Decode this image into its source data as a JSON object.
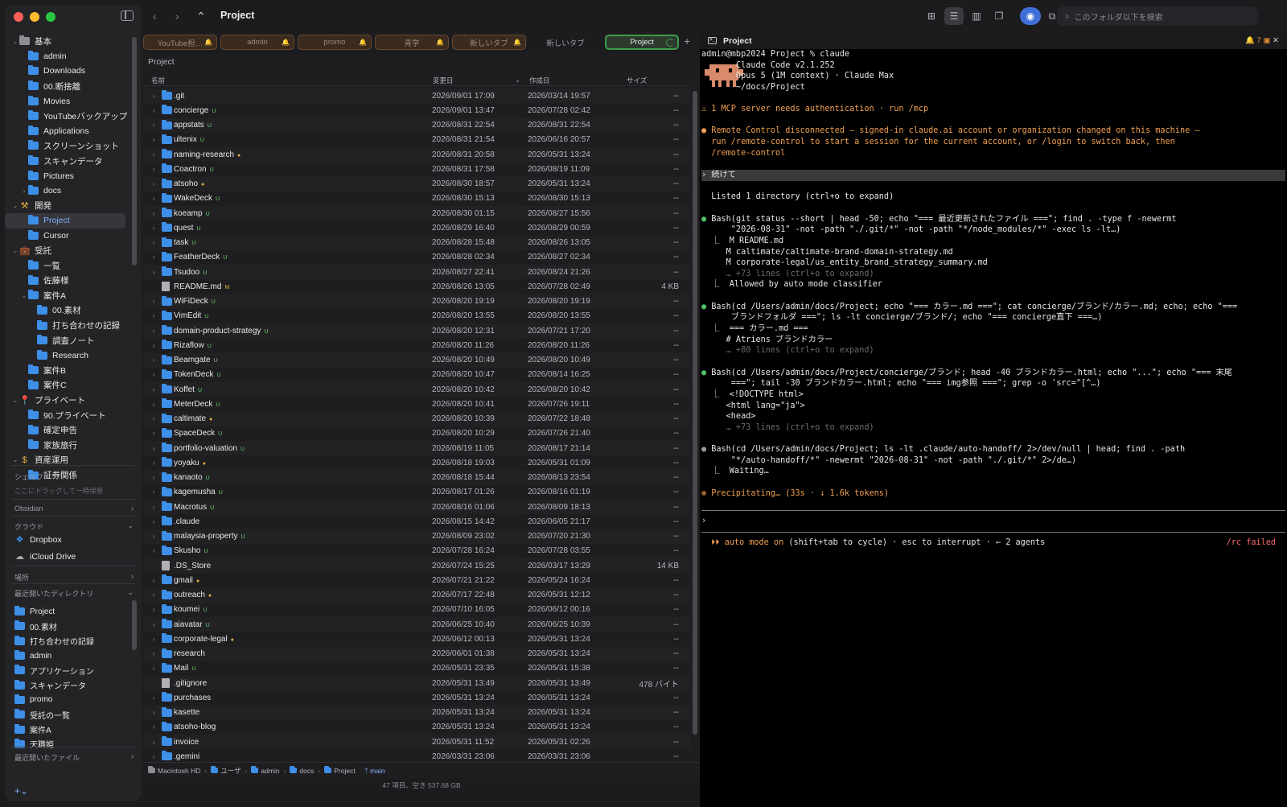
{
  "window": {
    "title": "Project"
  },
  "sidebar": {
    "tree": [
      {
        "label": "基本",
        "chev": "⌄",
        "icon": "grey",
        "indent": 0
      },
      {
        "label": "admin",
        "indent": 1,
        "icon": "folder"
      },
      {
        "label": "Downloads",
        "indent": 1,
        "icon": "folder"
      },
      {
        "label": "00.断捨離",
        "indent": 1,
        "icon": "folder"
      },
      {
        "label": "Movies",
        "indent": 1,
        "icon": "folder"
      },
      {
        "label": "YouTubeバックアップ",
        "indent": 1,
        "icon": "folder"
      },
      {
        "label": "Applications",
        "indent": 1,
        "icon": "folder"
      },
      {
        "label": "スクリーンショット",
        "indent": 1,
        "icon": "folder"
      },
      {
        "label": "スキャンデータ",
        "indent": 1,
        "icon": "folder"
      },
      {
        "label": "Pictures",
        "indent": 1,
        "icon": "folder"
      },
      {
        "label": "docs",
        "indent": 1,
        "chev": "›",
        "icon": "folder"
      },
      {
        "label": "開発",
        "chev": "⌄",
        "indent": 0,
        "icon": "hammer"
      },
      {
        "label": "Project",
        "indent": 1,
        "icon": "folder",
        "selected": true
      },
      {
        "label": "Cursor",
        "indent": 1,
        "icon": "folder"
      },
      {
        "label": "受託",
        "chev": "⌄",
        "indent": 0,
        "icon": "briefcase"
      },
      {
        "label": "一覧",
        "indent": 1,
        "icon": "folder"
      },
      {
        "label": "佐藤様",
        "indent": 1,
        "icon": "folder"
      },
      {
        "label": "案件A",
        "indent": 1,
        "chev": "⌄",
        "icon": "folder"
      },
      {
        "label": "00.素材",
        "indent": 2,
        "icon": "folder"
      },
      {
        "label": "打ち合わせの記録",
        "indent": 2,
        "icon": "folder"
      },
      {
        "label": "調査ノート",
        "indent": 2,
        "icon": "folder"
      },
      {
        "label": "Research",
        "indent": 2,
        "icon": "folder"
      },
      {
        "label": "案件B",
        "indent": 1,
        "icon": "folder"
      },
      {
        "label": "案件C",
        "indent": 1,
        "icon": "folder"
      },
      {
        "label": "プライベート",
        "chev": "⌄",
        "indent": 0,
        "icon": "pin"
      },
      {
        "label": "90.プライベート",
        "indent": 1,
        "icon": "folder"
      },
      {
        "label": "確定申告",
        "indent": 1,
        "icon": "folder"
      },
      {
        "label": "家族旅行",
        "indent": 1,
        "icon": "folder"
      },
      {
        "label": "資産運用",
        "chev": "⌄",
        "indent": 0,
        "icon": "dollar"
      },
      {
        "label": "証券関係",
        "indent": 1,
        "icon": "folder"
      }
    ],
    "shelf_title": "シェルフ",
    "shelf_hint": "ここにドラッグして一時保管",
    "obsidian": "Obsidian",
    "cloud_title": "クラウド",
    "dropbox": "Dropbox",
    "icloud": "iCloud Drive",
    "places": "場所",
    "recent_dirs_title": "最近開いたディレクトリ",
    "recent_dirs": [
      "Project",
      "00.素材",
      "打ち合わせの記録",
      "admin",
      "アプリケーション",
      "スキャンデータ",
      "promo",
      "受託の一覧",
      "案件A",
      "天職姫"
    ],
    "recent_files": "最近開いたファイル",
    "add": "+⌄"
  },
  "toolbar": {
    "back": "‹",
    "forward": "›",
    "up": "⌃",
    "search_placeholder": "このフォルダ以下を検索"
  },
  "tabs": [
    {
      "label": "YouTube担…",
      "style": "bell"
    },
    {
      "label": "admin",
      "style": "bell"
    },
    {
      "label": "promo",
      "style": "bell"
    },
    {
      "label": "青学",
      "style": "bell"
    },
    {
      "label": "新しいタブ",
      "style": "bell"
    },
    {
      "label": "新しいタブ",
      "style": "plain"
    },
    {
      "label": "Project",
      "style": "active"
    }
  ],
  "filelist": {
    "path_title": "Project",
    "columns": {
      "name": "名前",
      "modified": "変更日",
      "created": "作成日",
      "size": "サイズ"
    },
    "rows": [
      {
        "n": ".git",
        "m": "2026/09/01 17:09",
        "c": "2026/03/14 19:57",
        "s": "--",
        "b": ""
      },
      {
        "n": "concierge",
        "m": "2026/09/01 13:47",
        "c": "2026/07/28 02:42",
        "s": "--",
        "b": "U"
      },
      {
        "n": "appstats",
        "m": "2026/08/31 22:54",
        "c": "2026/08/31 22:54",
        "s": "--",
        "b": "U"
      },
      {
        "n": "ultenix",
        "m": "2026/08/31 21:54",
        "c": "2026/06/16 20:57",
        "s": "--",
        "b": "U"
      },
      {
        "n": "naming-research",
        "m": "2026/08/31 20:58",
        "c": "2026/05/31 13:24",
        "s": "--",
        "b": "●"
      },
      {
        "n": "Coactron",
        "m": "2026/08/31 17:58",
        "c": "2026/08/19 11:09",
        "s": "--",
        "b": "U"
      },
      {
        "n": "atsoho",
        "m": "2026/08/30 18:57",
        "c": "2026/05/31 13:24",
        "s": "--",
        "b": "●"
      },
      {
        "n": "WakeDeck",
        "m": "2026/08/30 15:13",
        "c": "2026/08/30 15:13",
        "s": "--",
        "b": "U"
      },
      {
        "n": "koeamp",
        "m": "2026/08/30 01:15",
        "c": "2026/08/27 15:56",
        "s": "--",
        "b": "U"
      },
      {
        "n": "quest",
        "m": "2026/08/29 16:40",
        "c": "2026/08/29 00:59",
        "s": "--",
        "b": "U"
      },
      {
        "n": "task",
        "m": "2026/08/28 15:48",
        "c": "2026/08/26 13:05",
        "s": "--",
        "b": "U"
      },
      {
        "n": "FeatherDeck",
        "m": "2026/08/28 02:34",
        "c": "2026/08/27 02:34",
        "s": "--",
        "b": "U"
      },
      {
        "n": "Tsudoo",
        "m": "2026/08/27 22:41",
        "c": "2026/08/24 21:26",
        "s": "--",
        "b": "U"
      },
      {
        "n": "README.md",
        "m": "2026/08/26 13:05",
        "c": "2026/07/28 02:49",
        "s": "4 KB",
        "b": "M",
        "file": true
      },
      {
        "n": "WiFiDeck",
        "m": "2026/08/20 19:19",
        "c": "2026/08/20 19:19",
        "s": "--",
        "b": "U"
      },
      {
        "n": "VimEdit",
        "m": "2026/08/20 13:55",
        "c": "2026/08/20 13:55",
        "s": "--",
        "b": "U"
      },
      {
        "n": "domain-product-strategy",
        "m": "2026/08/20 12:31",
        "c": "2026/07/21 17:20",
        "s": "--",
        "b": "U"
      },
      {
        "n": "Rizaflow",
        "m": "2026/08/20 11:26",
        "c": "2026/08/20 11:26",
        "s": "--",
        "b": "U"
      },
      {
        "n": "Beamgate",
        "m": "2026/08/20 10:49",
        "c": "2026/08/20 10:49",
        "s": "--",
        "b": "U"
      },
      {
        "n": "TokenDeck",
        "m": "2026/08/20 10:47",
        "c": "2026/08/14 16:25",
        "s": "--",
        "b": "U"
      },
      {
        "n": "Koffet",
        "m": "2026/08/20 10:42",
        "c": "2026/08/20 10:42",
        "s": "--",
        "b": "U"
      },
      {
        "n": "MeterDeck",
        "m": "2026/08/20 10:41",
        "c": "2026/07/26 19:11",
        "s": "--",
        "b": "U"
      },
      {
        "n": "caltimate",
        "m": "2026/08/20 10:39",
        "c": "2026/07/22 18:48",
        "s": "--",
        "b": "●"
      },
      {
        "n": "SpaceDeck",
        "m": "2026/08/20 10:29",
        "c": "2026/07/26 21:40",
        "s": "--",
        "b": "U"
      },
      {
        "n": "portfolio-valuation",
        "m": "2026/08/19 11:05",
        "c": "2026/08/17 21:14",
        "s": "--",
        "b": "U"
      },
      {
        "n": "yoyaku",
        "m": "2026/08/18 19:03",
        "c": "2026/05/31 01:09",
        "s": "--",
        "b": "●"
      },
      {
        "n": "kanaoto",
        "m": "2026/08/18 15:44",
        "c": "2026/08/13 23:54",
        "s": "--",
        "b": "U"
      },
      {
        "n": "kagemusha",
        "m": "2026/08/17 01:26",
        "c": "2026/08/16 01:19",
        "s": "--",
        "b": "U"
      },
      {
        "n": "Macrotus",
        "m": "2026/08/16 01:06",
        "c": "2026/08/09 18:13",
        "s": "--",
        "b": "U"
      },
      {
        "n": ".claude",
        "m": "2026/08/15 14:42",
        "c": "2026/06/05 21:17",
        "s": "--",
        "b": ""
      },
      {
        "n": "malaysia-property",
        "m": "2026/08/09 23:02",
        "c": "2026/07/20 21:30",
        "s": "--",
        "b": "U"
      },
      {
        "n": "Skusho",
        "m": "2026/07/28 16:24",
        "c": "2026/07/28 03:55",
        "s": "--",
        "b": "U"
      },
      {
        "n": ".DS_Store",
        "m": "2026/07/24 15:25",
        "c": "2026/03/17 13:29",
        "s": "14 KB",
        "b": "",
        "file": true
      },
      {
        "n": "gmail",
        "m": "2026/07/21 21:22",
        "c": "2026/05/24 16:24",
        "s": "--",
        "b": "●"
      },
      {
        "n": "outreach",
        "m": "2026/07/17 22:48",
        "c": "2026/05/31 12:12",
        "s": "--",
        "b": "●"
      },
      {
        "n": "koumei",
        "m": "2026/07/10 16:05",
        "c": "2026/06/12 00:16",
        "s": "--",
        "b": "U"
      },
      {
        "n": "aiavatar",
        "m": "2026/06/25 10:40",
        "c": "2026/06/25 10:39",
        "s": "--",
        "b": "U"
      },
      {
        "n": "corporate-legal",
        "m": "2026/06/12 00:13",
        "c": "2026/05/31 13:24",
        "s": "--",
        "b": "●"
      },
      {
        "n": "research",
        "m": "2026/06/01 01:38",
        "c": "2026/05/31 13:24",
        "s": "--",
        "b": ""
      },
      {
        "n": "Mail",
        "m": "2026/05/31 23:35",
        "c": "2026/05/31 15:38",
        "s": "--",
        "b": "U"
      },
      {
        "n": ".gitignore",
        "m": "2026/05/31 13:49",
        "c": "2026/05/31 13:49",
        "s": "478 バイト",
        "b": "",
        "file": true
      },
      {
        "n": "purchases",
        "m": "2026/05/31 13:24",
        "c": "2026/05/31 13:24",
        "s": "--",
        "b": ""
      },
      {
        "n": "kasette",
        "m": "2026/05/31 13:24",
        "c": "2026/05/31 13:24",
        "s": "--",
        "b": ""
      },
      {
        "n": "atsoho-blog",
        "m": "2026/05/31 13:24",
        "c": "2026/05/31 13:24",
        "s": "--",
        "b": ""
      },
      {
        "n": "invoice",
        "m": "2026/05/31 11:52",
        "c": "2026/05/31 02:26",
        "s": "--",
        "b": ""
      },
      {
        "n": ".gemini",
        "m": "2026/03/31 23:06",
        "c": "2026/03/31 23:06",
        "s": "--",
        "b": ""
      }
    ],
    "breadcrumb": [
      "Macintosh HD",
      "ユーザ",
      "admin",
      "docs",
      "Project"
    ],
    "branch": "main",
    "summary": "47 項目、空き 537.68 GB"
  },
  "terminal": {
    "title": "Project",
    "notif": "🔔 7",
    "lines": [
      {
        "t": "admin@mbp2024 Project % claude",
        "c": ""
      },
      {
        "t": "       Claude Code v2.1.252",
        "c": ""
      },
      {
        "t": "       Opus 5 (1M context) · Claude Max",
        "c": ""
      },
      {
        "t": "       ~/docs/Project",
        "c": ""
      },
      {
        "t": "",
        "c": ""
      },
      {
        "t": "⚠ 1 MCP server needs authentication · run /mcp",
        "c": "c-orange"
      },
      {
        "t": "",
        "c": ""
      },
      {
        "t": "● Remote Control disconnected — signed-in claude.ai account or organization changed on this machine —",
        "c": "c-orange"
      },
      {
        "t": "  run /remote-control to start a session for the current account, or /login to switch back, then",
        "c": "c-orange"
      },
      {
        "t": "  /remote-control",
        "c": "c-orange"
      },
      {
        "t": "",
        "c": ""
      },
      {
        "t": "› 続けて",
        "c": "input-band"
      },
      {
        "t": "",
        "c": ""
      },
      {
        "t": "  Listed 1 directory (ctrl+o to expand)",
        "c": ""
      },
      {
        "t": "",
        "c": ""
      },
      {
        "t": "● Bash(git status --short | head -50; echo \"=== 最近更新されたファイル ===\"; find . -type f -newermt",
        "c": "bash"
      },
      {
        "t": "      \"2026-08-31\" -not -path \"./.git/*\" -not -path \"*/node_modules/*\" -exec ls -lt…)",
        "c": ""
      },
      {
        "t": "  ⎿  M README.md",
        "c": ""
      },
      {
        "t": "     M caltimate/caltimate-brand-domain-strategy.md",
        "c": ""
      },
      {
        "t": "     M corporate-legal/us_entity_brand_strategy_summary.md",
        "c": ""
      },
      {
        "t": "     … +73 lines (ctrl+o to expand)",
        "c": "c-dim"
      },
      {
        "t": "  ⎿  Allowed by auto mode classifier",
        "c": ""
      },
      {
        "t": "",
        "c": ""
      },
      {
        "t": "● Bash(cd /Users/admin/docs/Project; echo \"=== カラー.md ===\"; cat concierge/ブランド/カラー.md; echo; echo \"===",
        "c": "bash"
      },
      {
        "t": "      ブランドフォルダ ===\"; ls -lt concierge/ブランド/; echo \"=== concierge直下 ===…)",
        "c": ""
      },
      {
        "t": "  ⎿  === カラー.md ===",
        "c": ""
      },
      {
        "t": "     # Atriens ブランドカラー",
        "c": ""
      },
      {
        "t": "     … +80 lines (ctrl+o to expand)",
        "c": "c-dim"
      },
      {
        "t": "",
        "c": ""
      },
      {
        "t": "● Bash(cd /Users/admin/docs/Project/concierge/ブランド; head -40 ブランドカラー.html; echo \"...\"; echo \"=== 末尾",
        "c": "bash"
      },
      {
        "t": "      ===\"; tail -30 ブランドカラー.html; echo \"=== img参照 ===\"; grep -o 'src=\"[^…)",
        "c": ""
      },
      {
        "t": "  ⎿  <!DOCTYPE html>",
        "c": ""
      },
      {
        "t": "     <html lang=\"ja\">",
        "c": ""
      },
      {
        "t": "     <head>",
        "c": ""
      },
      {
        "t": "     … +73 lines (ctrl+o to expand)",
        "c": "c-dim"
      },
      {
        "t": "",
        "c": ""
      },
      {
        "t": "● Bash(cd /Users/admin/docs/Project; ls -lt .claude/auto-handoff/ 2>/dev/null | head; find . -path",
        "c": "bashgrey"
      },
      {
        "t": "      \"*/auto-handoff/*\" -newermt \"2026-08-31\" -not -path \"./.git/*\" 2>/de…)",
        "c": ""
      },
      {
        "t": "  ⎿  Waiting…",
        "c": ""
      },
      {
        "t": "",
        "c": ""
      },
      {
        "t": "✻ Precipitating… (33s · ↓ 1.6k tokens)",
        "c": "c-orange"
      }
    ],
    "prompt": "›",
    "footer_mode": "⏵⏵ auto mode on",
    "footer_rest": " (shift+tab to cycle) · esc to interrupt · ← 2 agents",
    "footer_right": "/rc failed"
  },
  "colors": {
    "accent": "#3d8fe8",
    "active_tab": "#3d9a4a",
    "warning": "#f0a050",
    "added": "#4fc36a"
  }
}
